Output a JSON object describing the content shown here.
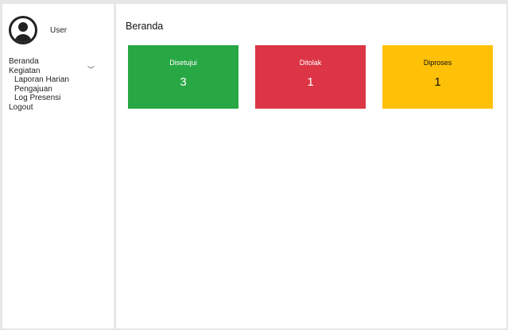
{
  "sidebar": {
    "user": {
      "name": "User",
      "avatar_icon": "user-circle-icon"
    },
    "nav": {
      "beranda": "Beranda",
      "kegiatan": "Kegiatan",
      "kegiatan_icon": "chevron-down-icon",
      "sub_items": [
        "Laporan Harian",
        "Pengajuan",
        "Log Presensi"
      ],
      "logout": "Logout"
    }
  },
  "main": {
    "title": "Beranda",
    "cards": [
      {
        "label": "Disetujui",
        "value": "3",
        "color": "#28a745"
      },
      {
        "label": "Ditolak",
        "value": "1",
        "color": "#dc3545"
      },
      {
        "label": "Diproses",
        "value": "1",
        "color": "#ffc107"
      }
    ]
  }
}
